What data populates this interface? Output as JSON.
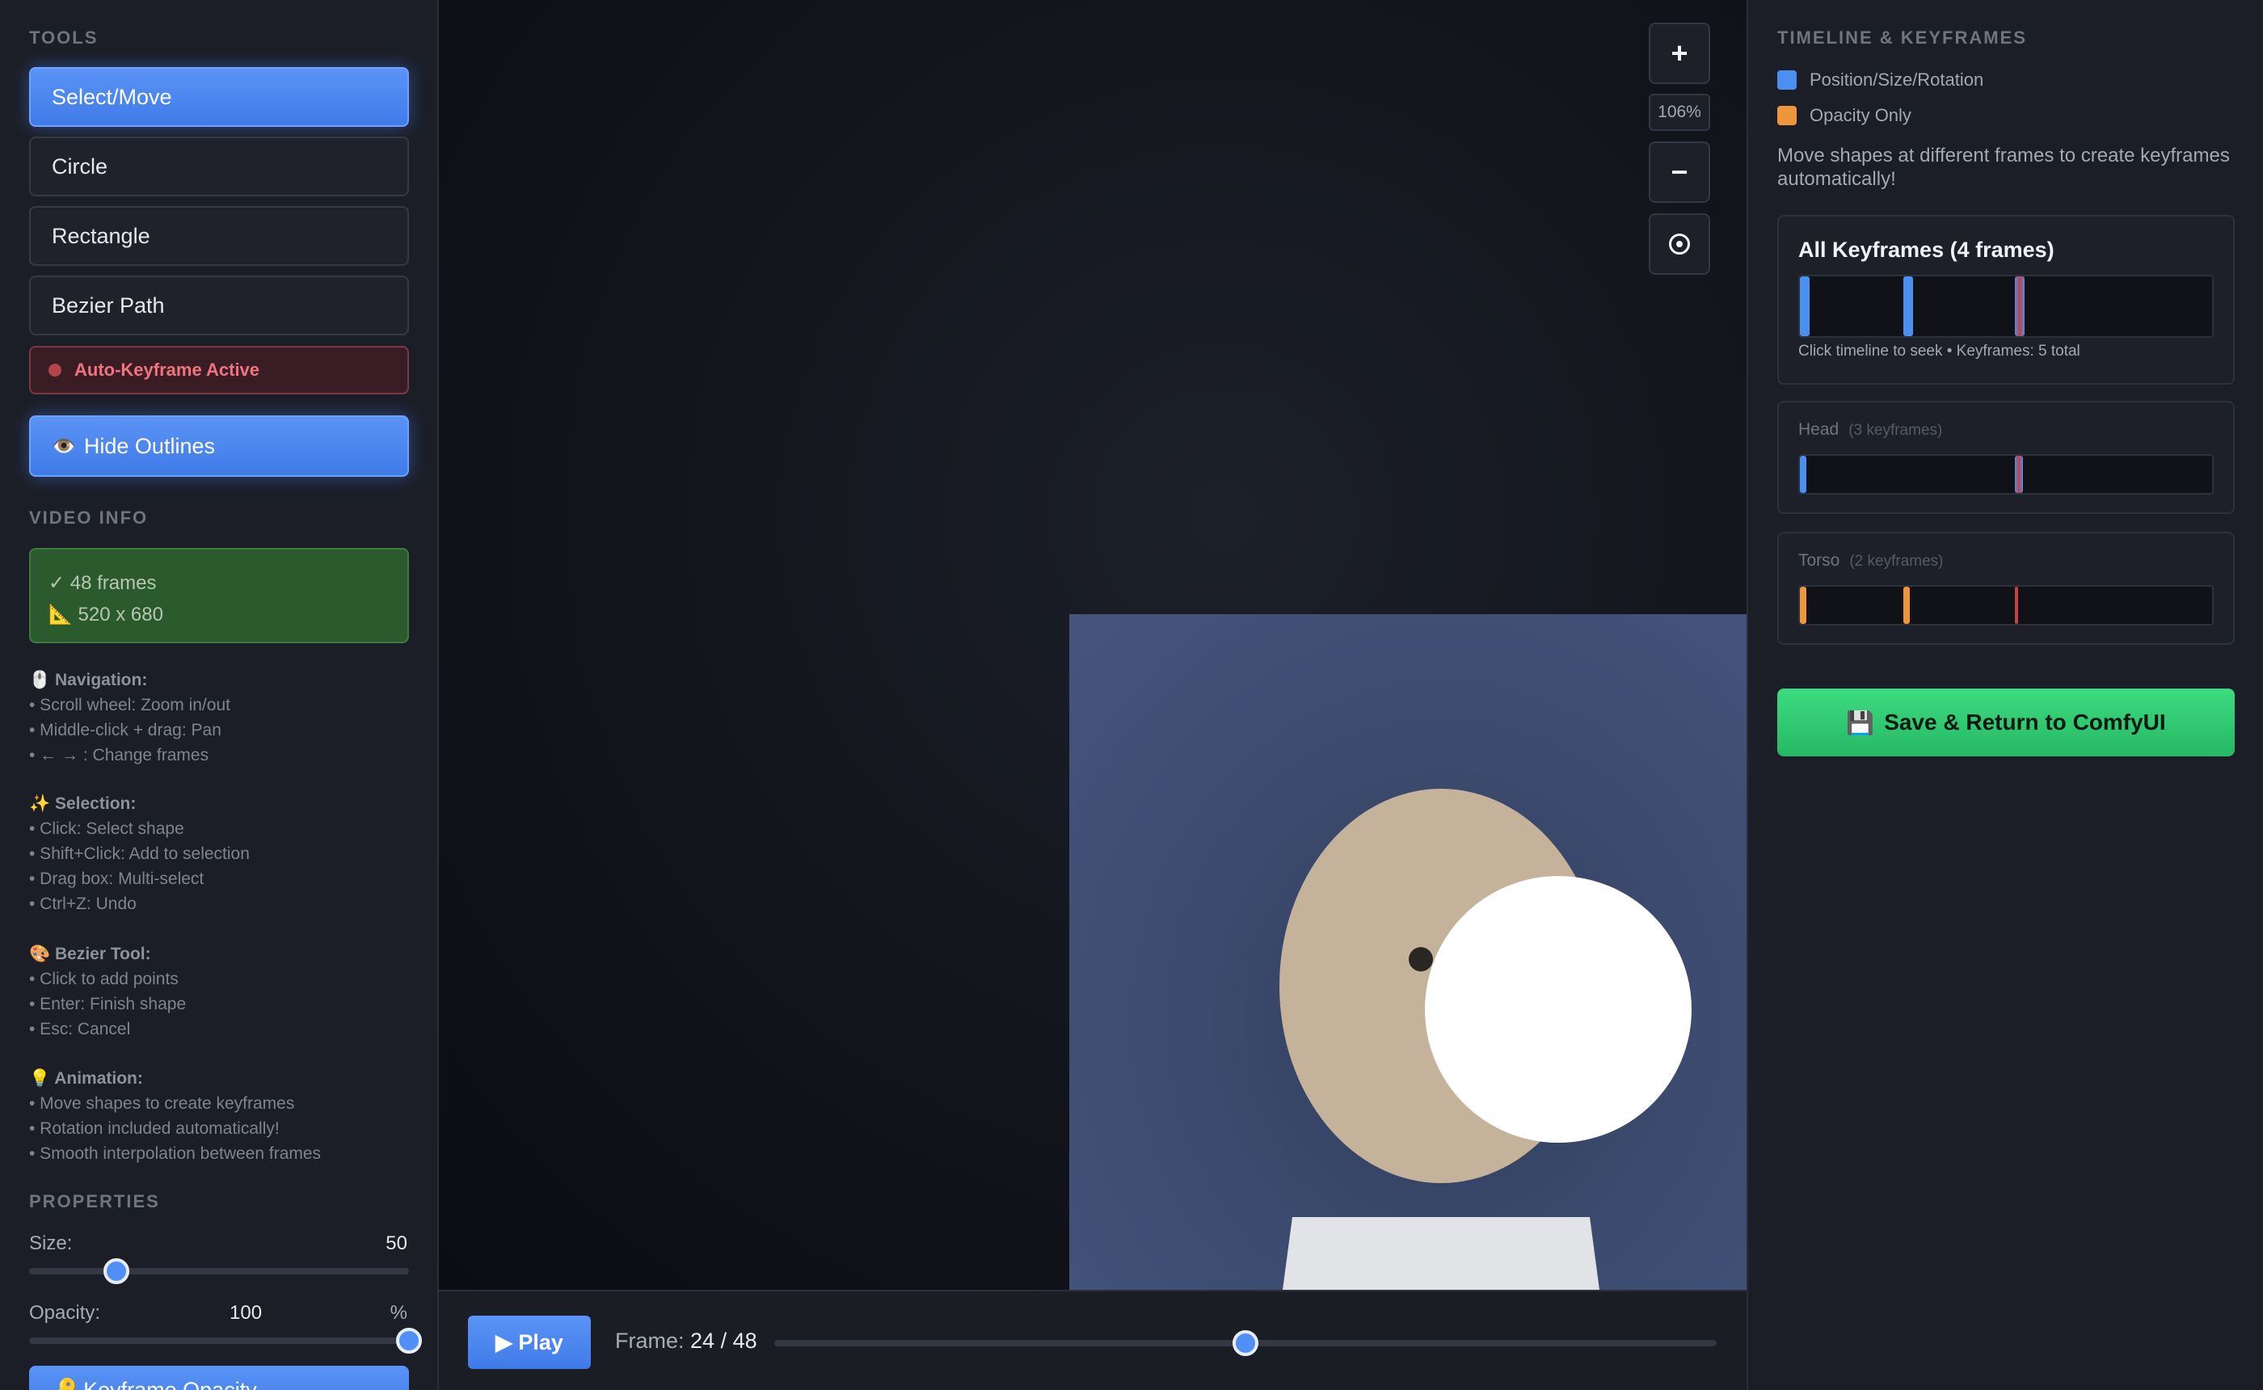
{
  "sidebar": {
    "tools_header": "TOOLS",
    "tools": [
      {
        "label": "Select/Move",
        "active": true
      },
      {
        "label": "Circle",
        "active": false
      },
      {
        "label": "Rectangle",
        "active": false
      },
      {
        "label": "Bezier Path",
        "active": false
      }
    ],
    "auto_keyframe": "Auto-Keyframe Active",
    "hide_outlines": {
      "icon": "👁️",
      "label": "Hide Outlines"
    },
    "video_info_header": "VIDEO INFO",
    "video_info": {
      "frames": "✓ 48 frames",
      "dimensions": "📐 520 x 680"
    },
    "help": [
      {
        "title": "🖱️ Navigation:",
        "lines": [
          "• Scroll wheel: Zoom in/out",
          "• Middle-click + drag: Pan",
          "• ← → : Change frames"
        ]
      },
      {
        "title": "✨ Selection:",
        "lines": [
          "• Click: Select shape",
          "• Shift+Click: Add to selection",
          "• Drag box: Multi-select",
          "• Ctrl+Z: Undo"
        ]
      },
      {
        "title": "🎨 Bezier Tool:",
        "lines": [
          "• Click to add points",
          "• Enter: Finish shape",
          "• Esc: Cancel"
        ]
      },
      {
        "title": "💡 Animation:",
        "lines": [
          "• Move shapes to create keyframes",
          "• Rotation included automatically!",
          "• Smooth interpolation between frames"
        ]
      }
    ],
    "properties_header": "PROPERTIES",
    "size": {
      "label": "Size:",
      "value": "50",
      "fraction": 0.23
    },
    "opacity": {
      "label": "Opacity:",
      "value": "100",
      "unit": "%",
      "fraction": 1.0
    },
    "keyframe_opacity": "🔑 Keyframe Opacity"
  },
  "canvas": {
    "zoom_in": "+",
    "zoom_level": "106%",
    "zoom_out": "−"
  },
  "playback": {
    "play_label": "▶ Play",
    "frame_label": "Frame:",
    "current_frame": "24",
    "separator": "/",
    "total_frames": "48",
    "fraction": 0.5
  },
  "timeline": {
    "header": "TIMELINE & KEYFRAMES",
    "legend": [
      {
        "label": "Position/Size/Rotation",
        "color": "#4a90f0"
      },
      {
        "label": "Opacity Only",
        "color": "#f0963a"
      }
    ],
    "description": "Move shapes at different frames to create keyframes automatically!",
    "all_keyframes": {
      "title": "All Keyframes (4 frames)",
      "caption": "Click timeline to seek • Keyframes: 5 total",
      "marks": [
        {
          "frame": 0,
          "type": "position"
        },
        {
          "frame": 12,
          "type": "position"
        },
        {
          "frame": 25,
          "type": "mixed"
        }
      ]
    },
    "layers": [
      {
        "name": "Head",
        "count": "(3 keyframes)",
        "marks": [
          {
            "frame": 0,
            "type": "position"
          },
          {
            "frame": 25,
            "type": "mixed"
          }
        ]
      },
      {
        "name": "Torso",
        "count": "(2 keyframes)",
        "marks": [
          {
            "frame": 0,
            "type": "opacity"
          },
          {
            "frame": 12,
            "type": "opacity"
          },
          {
            "frame": 25,
            "type": "current"
          }
        ]
      }
    ],
    "save_button": {
      "icon": "💾",
      "label": "Save & Return to ComfyUI"
    }
  },
  "colors": {
    "accent": "#4f8ff7",
    "position_kf": "#4a90f0",
    "opacity_kf": "#f0963a",
    "current_frame": "#c5413f",
    "save": "#2ec96f"
  }
}
